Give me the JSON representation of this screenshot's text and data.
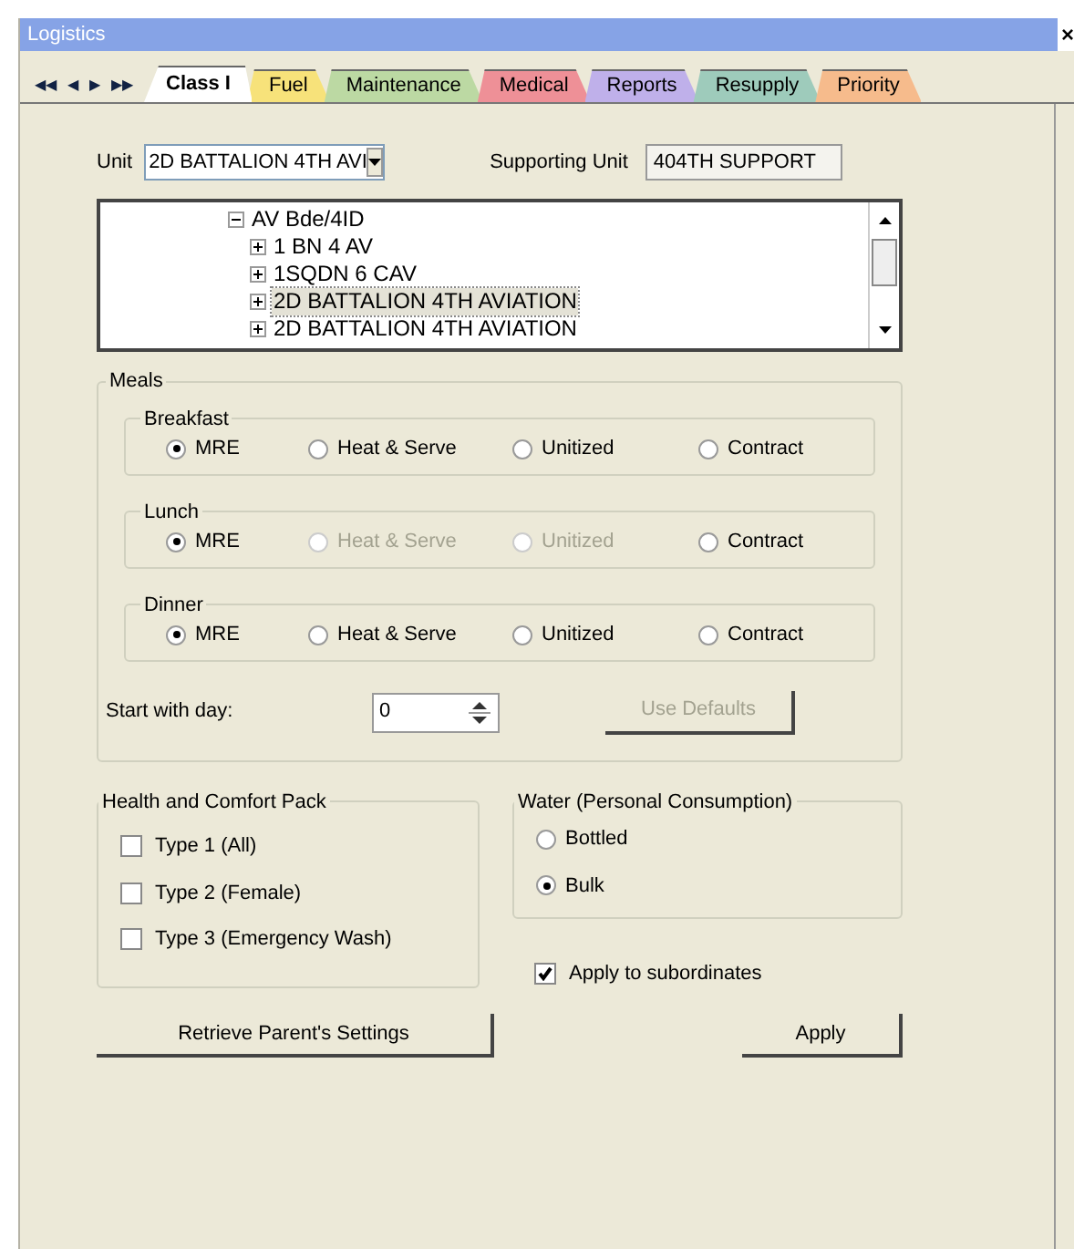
{
  "window": {
    "title": "Logistics",
    "close": "×"
  },
  "tab_nav": [
    "◀◀",
    "◀",
    "▶",
    "▶▶"
  ],
  "tabs": [
    {
      "label": "Class I",
      "selected": true,
      "color": "#ffffff"
    },
    {
      "label": "Fuel",
      "selected": false,
      "color": "#f7e27a"
    },
    {
      "label": "Maintenance",
      "selected": false,
      "color": "#bcd9a3"
    },
    {
      "label": "Medical",
      "selected": false,
      "color": "#ee9097"
    },
    {
      "label": "Reports",
      "selected": false,
      "color": "#bfb0ea"
    },
    {
      "label": "Resupply",
      "selected": false,
      "color": "#9ecbbb"
    },
    {
      "label": "Priority",
      "selected": false,
      "color": "#f6bb8c"
    }
  ],
  "unit": {
    "label": "Unit",
    "value": "2D BATTALION 4TH AVI"
  },
  "supporting_unit": {
    "label": "Supporting Unit",
    "value": "404TH SUPPORT"
  },
  "tree": [
    {
      "label": "AV Bde/4ID",
      "expanded": true,
      "children": [
        {
          "label": "1 BN 4 AV",
          "expanded": false,
          "selected": false
        },
        {
          "label": "1SQDN 6 CAV",
          "expanded": false,
          "selected": false
        },
        {
          "label": "2D BATTALION 4TH AVIATION",
          "expanded": false,
          "selected": true
        },
        {
          "label": "2D BATTALION 4TH AVIATION",
          "expanded": false,
          "selected": false
        }
      ]
    }
  ],
  "meals": {
    "title": "Meals",
    "groups": [
      {
        "title": "Breakfast",
        "options": [
          {
            "label": "MRE",
            "selected": true,
            "disabled": false
          },
          {
            "label": "Heat & Serve",
            "selected": false,
            "disabled": false
          },
          {
            "label": "Unitized",
            "selected": false,
            "disabled": false
          },
          {
            "label": "Contract",
            "selected": false,
            "disabled": false
          }
        ]
      },
      {
        "title": "Lunch",
        "options": [
          {
            "label": "MRE",
            "selected": true,
            "disabled": false
          },
          {
            "label": "Heat & Serve",
            "selected": false,
            "disabled": true
          },
          {
            "label": "Unitized",
            "selected": false,
            "disabled": true
          },
          {
            "label": "Contract",
            "selected": false,
            "disabled": false
          }
        ]
      },
      {
        "title": "Dinner",
        "options": [
          {
            "label": "MRE",
            "selected": true,
            "disabled": false
          },
          {
            "label": "Heat & Serve",
            "selected": false,
            "disabled": false
          },
          {
            "label": "Unitized",
            "selected": false,
            "disabled": false
          },
          {
            "label": "Contract",
            "selected": false,
            "disabled": false
          }
        ]
      }
    ],
    "start_day": {
      "label": "Start with day:",
      "value": "0"
    },
    "defaults_button": {
      "label": "Use Defaults",
      "disabled": true
    }
  },
  "health_pack": {
    "title": "Health and Comfort Pack",
    "items": [
      {
        "label": "Type 1 (All)",
        "checked": false
      },
      {
        "label": "Type 2 (Female)",
        "checked": false
      },
      {
        "label": "Type 3 (Emergency Wash)",
        "checked": false
      }
    ]
  },
  "water": {
    "title": "Water (Personal Consumption)",
    "options": [
      {
        "label": "Bottled",
        "selected": false
      },
      {
        "label": "Bulk",
        "selected": true
      }
    ]
  },
  "apply_subordinates": {
    "label": "Apply to subordinates",
    "checked": true
  },
  "buttons": [
    "Retrieve Parent's Settings",
    "Apply"
  ]
}
